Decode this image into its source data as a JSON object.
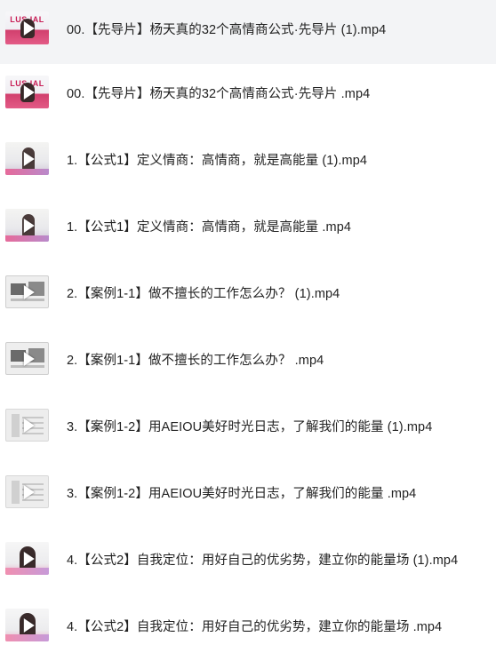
{
  "files": [
    {
      "name": "00.【先导片】杨天真的32个高情商公式·先导片 (1).mp4",
      "thumb_text": "LUS  IAL",
      "selected": true
    },
    {
      "name": "00.【先导片】杨天真的32个高情商公式·先导片 .mp4",
      "thumb_text": "LUS  IAL",
      "selected": false
    },
    {
      "name": "1.【公式1】定义情商：高情商，就是高能量 (1).mp4",
      "selected": false
    },
    {
      "name": "1.【公式1】定义情商：高情商，就是高能量 .mp4",
      "selected": false
    },
    {
      "name": "2.【案例1-1】做不擅长的工作怎么办？ (1).mp4",
      "selected": false
    },
    {
      "name": "2.【案例1-1】做不擅长的工作怎么办？ .mp4",
      "selected": false
    },
    {
      "name": "3.【案例1-2】用AEIOU美好时光日志，了解我们的能量 (1).mp4",
      "selected": false
    },
    {
      "name": "3.【案例1-2】用AEIOU美好时光日志，了解我们的能量 .mp4",
      "selected": false
    },
    {
      "name": "4.【公式2】自我定位：用好自己的优劣势，建立你的能量场 (1).mp4",
      "selected": false
    },
    {
      "name": "4.【公式2】自我定位：用好自己的优劣势，建立你的能量场 .mp4",
      "selected": false
    }
  ],
  "icons": {
    "play": "play-icon"
  },
  "colors": {
    "selected_bg": "#f3f4f6",
    "text": "#222222",
    "brand_pink": "#d13f6d"
  }
}
